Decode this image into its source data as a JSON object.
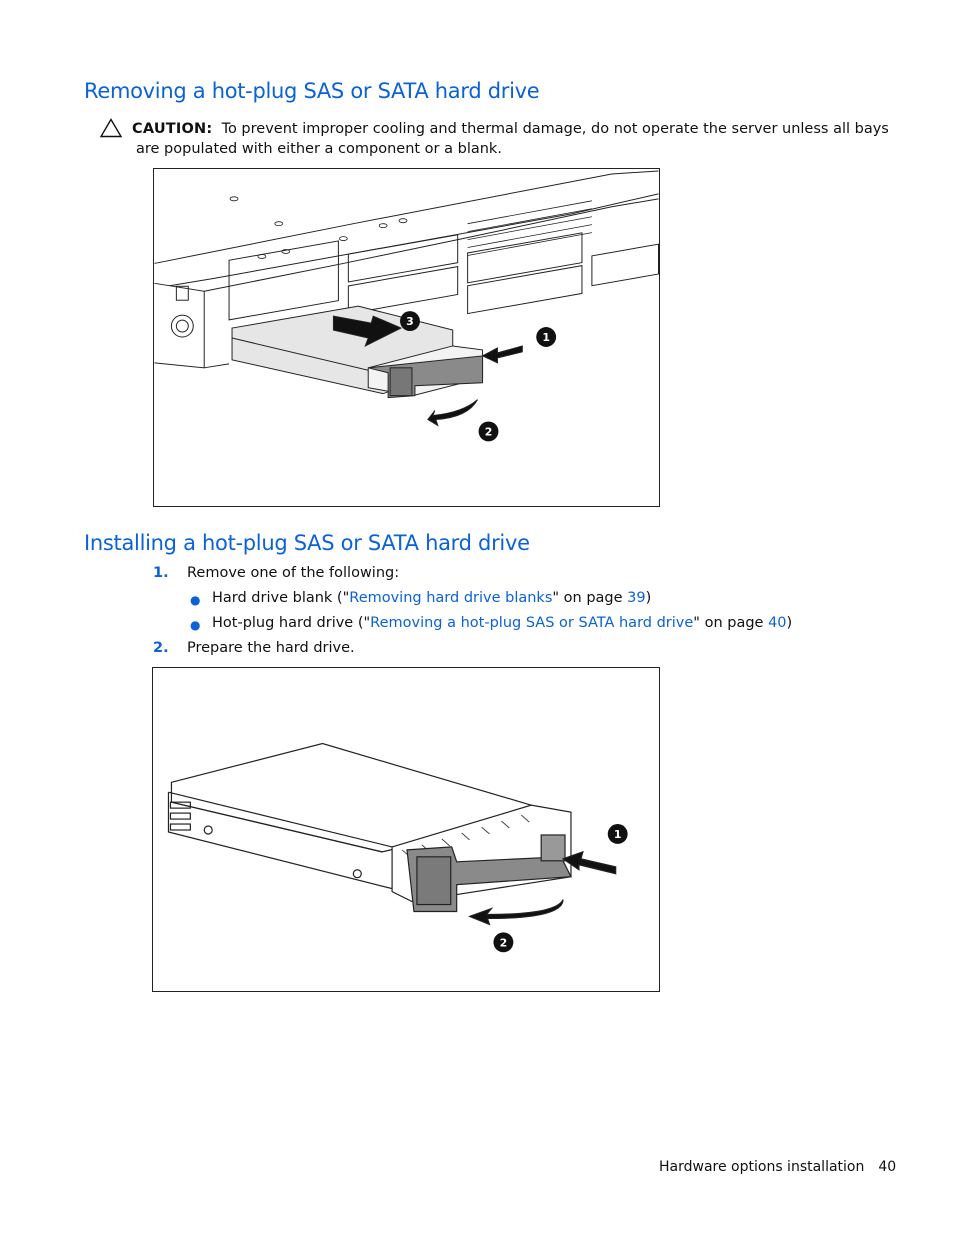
{
  "section1": {
    "title": "Removing a hot-plug SAS or SATA hard drive",
    "caution": {
      "icon": "warning-triangle-icon",
      "label": "CAUTION:",
      "text_line1": "To prevent improper cooling and thermal damage, do not operate the server unless all bays",
      "text_line2": "are populated with either a component or a blank."
    },
    "figure": {
      "description": "Removing a hard drive from the server bay",
      "callouts": [
        "1",
        "2",
        "3"
      ]
    }
  },
  "section2": {
    "title": "Installing a hot-plug SAS or SATA hard drive",
    "steps": [
      {
        "number": "1.",
        "text": "Remove one of the following:",
        "bullets": [
          {
            "prefix": "Hard drive blank (\"",
            "link": "Removing hard drive blanks",
            "middle": "\" on page ",
            "page_link": "39",
            "suffix": ")"
          },
          {
            "prefix": "Hot-plug hard drive (\"",
            "link": "Removing a hot-plug SAS or SATA hard drive",
            "middle": "\" on page ",
            "page_link": "40",
            "suffix": ")"
          }
        ]
      },
      {
        "number": "2.",
        "text": "Prepare the hard drive."
      }
    ],
    "figure": {
      "description": "Preparing the hard drive by releasing the lever",
      "callouts": [
        "1",
        "2"
      ]
    }
  },
  "footer": {
    "section": "Hardware options installation",
    "page_number": "40"
  },
  "colors": {
    "heading": "#0a62d6",
    "link": "#0a62d6",
    "text": "#111111"
  }
}
